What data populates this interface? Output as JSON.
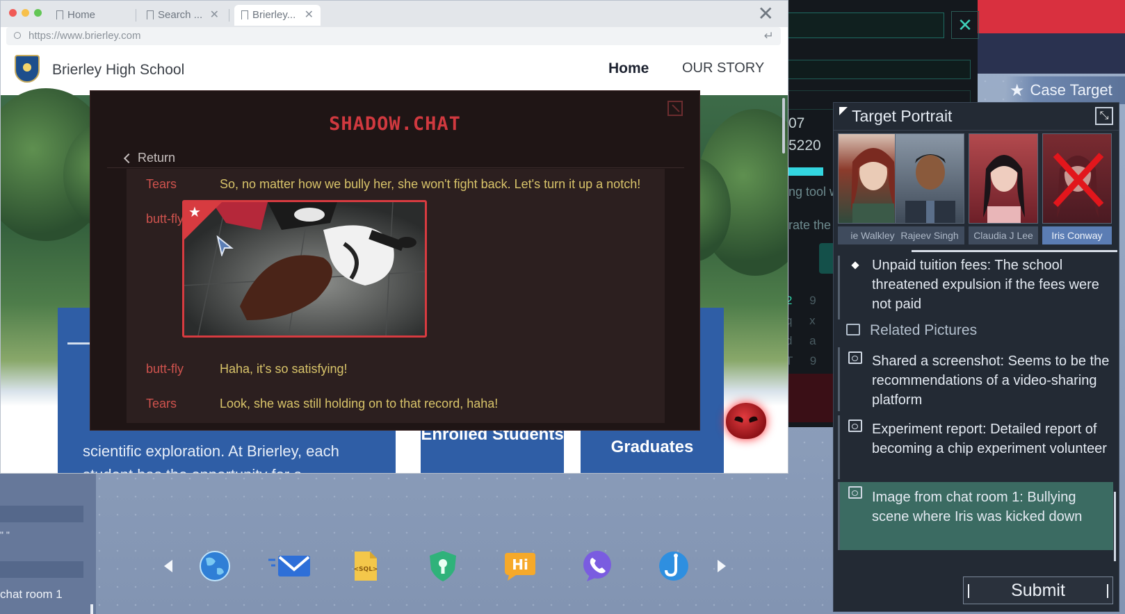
{
  "browser": {
    "tabs": [
      {
        "label": "Home",
        "closable": false
      },
      {
        "label": "Search ...",
        "closable": true
      },
      {
        "label": "Brierley...",
        "closable": true
      }
    ],
    "close_glyph": "✕",
    "url": "https://www.brierley.com"
  },
  "site": {
    "school_name": "Brierley High School",
    "nav": {
      "home": "Home",
      "our_story": "OUR STORY"
    },
    "card_text": "scientific exploration. At Brierley, each student has the opportunity for a",
    "stat_enrolled": "Enrolled Students",
    "stat_graduates": "Graduates"
  },
  "shadow_chat": {
    "title": "SHADOW.CHAT",
    "return_label": "Return",
    "messages": [
      {
        "user": "Tears",
        "text": "So, no matter how we bully her, she won't fight back. Let's turn it up a notch!"
      },
      {
        "user": "butt-fly",
        "text": ""
      },
      {
        "user": "butt-fly",
        "text": "Haha, it's so satisfying!"
      },
      {
        "user": "Tears",
        "text": "Look, she was still holding on to that record, haha!"
      }
    ],
    "accent_color": "#d73b40"
  },
  "tool_window": {
    "close_glyph": "✕",
    "num1": "07",
    "num2": "5220",
    "frag1": "ng tool w",
    "frag2": "rate the",
    "keys_line1_on": "2",
    "keys_line1_off": "9",
    "keys_line2": "q x",
    "keys_line3": "d a",
    "keys_line4": "T 9"
  },
  "case_target": {
    "label": "Case Target",
    "icon": "star-icon"
  },
  "target_portrait": {
    "title": "Target Portrait",
    "portraits": [
      {
        "name": "ie Walkley",
        "active": false
      },
      {
        "name": "Rajeev Singh",
        "active": false
      },
      {
        "name": "Claudia J Lee",
        "active": false
      },
      {
        "name": "Iris Conway",
        "active": true
      }
    ],
    "clues": {
      "tuition": "Unpaid tuition fees: The school threatened expulsion if the fees were not paid"
    },
    "related_title": "Related Pictures",
    "related": [
      {
        "text": "Shared a screenshot: Seems to be the recommendations of a video-sharing platform",
        "highlight": false
      },
      {
        "text": "Experiment report: Detailed report of becoming a chip experiment volunteer",
        "highlight": false
      },
      {
        "text": "Image from chat room 1: Bullying scene where Iris was kicked down",
        "highlight": true
      }
    ],
    "submit_label": "Submit"
  },
  "side_panel": {
    "quote": "\" \"",
    "label": "chat room 1"
  },
  "dock": {
    "apps": [
      "globe-icon",
      "mail-icon",
      "sql-file-icon",
      "keyhole-shield-icon",
      "hi-chat-icon",
      "phone-icon",
      "hook-icon"
    ],
    "hi_label": "Hi",
    "sql_label": "<SQL>"
  }
}
